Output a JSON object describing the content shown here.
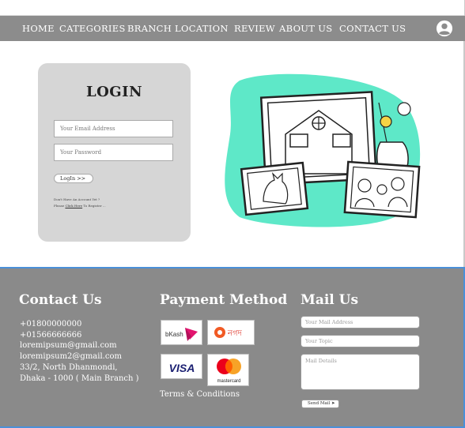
{
  "nav": {
    "items": [
      {
        "label": "HOME"
      },
      {
        "label": "CATEGORIES"
      },
      {
        "label": "BRANCH LOCATION"
      },
      {
        "label": "REVIEW"
      },
      {
        "label": "ABOUT US"
      },
      {
        "label": "CONTACT US"
      }
    ],
    "account_icon": "user-circle-icon"
  },
  "login": {
    "title": "LOGIN",
    "email_placeholder": "Your Email Address",
    "password_placeholder": "Your Password",
    "button_label": "LogIn  >>",
    "no_account_text": "Don't Have An Account Yet ?",
    "please_text": "Please",
    "click_here_text": "Click Here",
    "register_text": "To Register  ..."
  },
  "illustration": {
    "icon": "home-family-frames-illustration",
    "accent_color": "#5ee8c8"
  },
  "footer": {
    "contact": {
      "heading": "Contact Us",
      "lines": [
        "+01800000000",
        "+01566666666",
        "loremipsum@gmail.com",
        "loremipsum2@gmail.com",
        "33/2, North Dhanmondi,",
        "Dhaka - 1000 ( Main Branch )"
      ]
    },
    "payment": {
      "heading": "Payment Method",
      "methods": [
        {
          "name": "bKash"
        },
        {
          "name": "নগদ"
        },
        {
          "name": "VISA"
        },
        {
          "name": "mastercard"
        }
      ],
      "terms_label": "Terms & Conditions"
    },
    "mail": {
      "heading": "Mail Us",
      "address_placeholder": "Your Mail Address",
      "topic_placeholder": "Your Topic",
      "details_placeholder": "Mail Details",
      "send_label": "Send Mail ➤"
    }
  },
  "colors": {
    "navbar": "#8c8c8c",
    "footer": "#8a8a8a",
    "card": "#d6d6d6",
    "footer_border": "#4a90d9"
  }
}
